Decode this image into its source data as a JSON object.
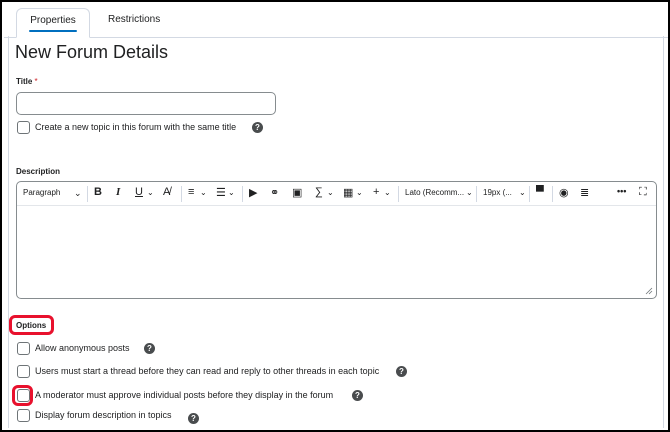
{
  "tabs": [
    {
      "label": "Properties",
      "active": true
    },
    {
      "label": "Restrictions",
      "active": false
    }
  ],
  "page_title": "New Forum Details",
  "title_field": {
    "label": "Title",
    "required_mark": "*",
    "value": "",
    "placeholder": ""
  },
  "create_topic": {
    "label": "Create a new topic in this forum with the same title",
    "checked": false,
    "help_icon": "question-circle"
  },
  "description": {
    "label": "Description",
    "toolbar": {
      "paragraph": "Paragraph",
      "bold": "B",
      "italic": "I",
      "underline": "U",
      "font_family": "Lato (Recomm...",
      "font_size": "19px (...",
      "more": "•••"
    },
    "value": ""
  },
  "options": {
    "heading": "Options",
    "items": [
      {
        "label": "Allow anonymous posts",
        "checked": false
      },
      {
        "label": "Users must start a thread before they can read and reply to other threads in each topic",
        "checked": false
      },
      {
        "label": "A moderator must approve individual posts before they display in the forum",
        "checked": false
      },
      {
        "label": "Display forum description in topics",
        "checked": false
      }
    ]
  },
  "colors": {
    "accent": "#006fbf",
    "highlight": "#e8112d"
  }
}
